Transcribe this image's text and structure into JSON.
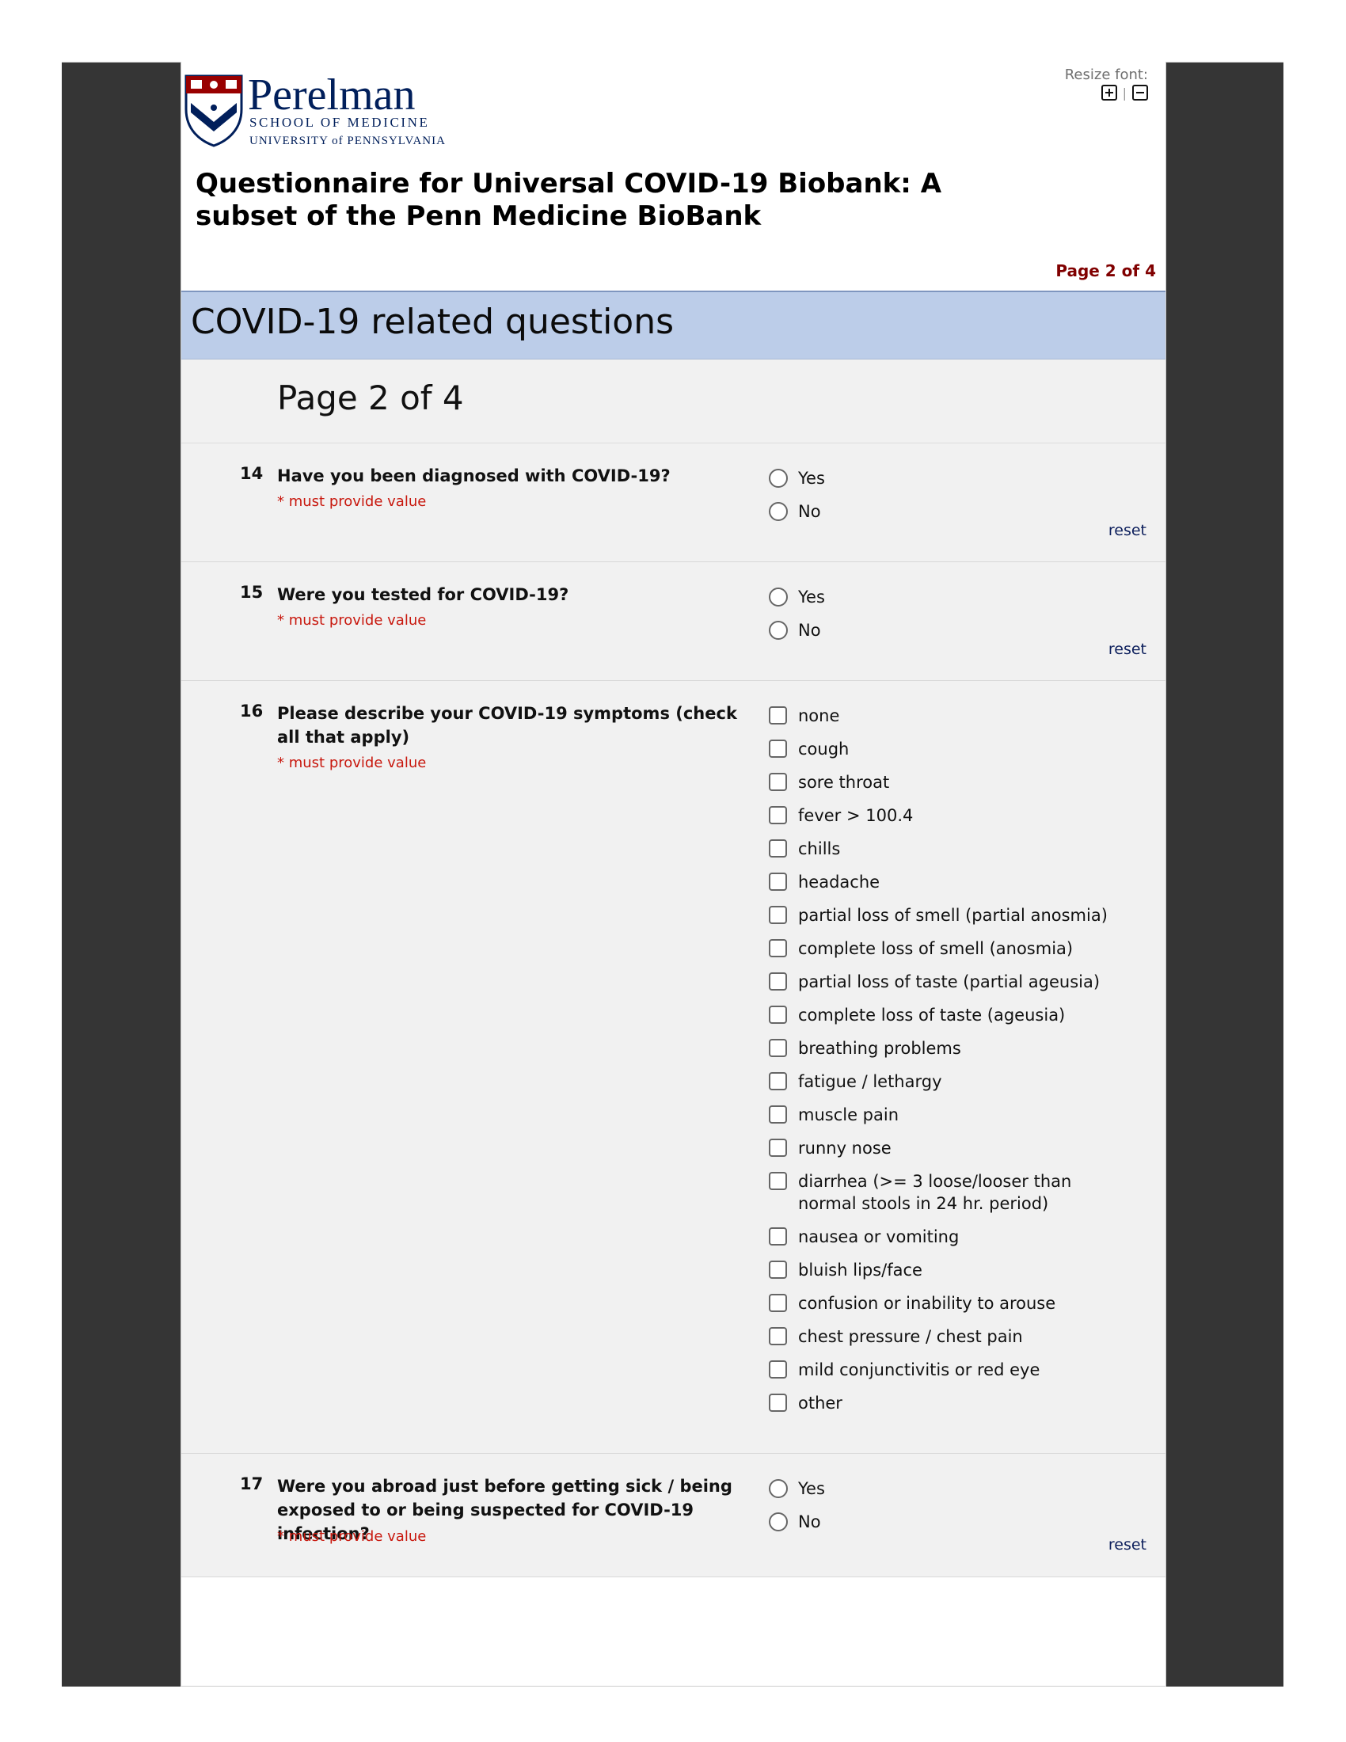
{
  "header": {
    "logo": {
      "name": "Perelman",
      "line1": "SCHOOL OF MEDICINE",
      "line2": "UNIVERSITY of PENNSYLVANIA"
    },
    "resize_font_label": "Resize font:",
    "resize_separator": "|",
    "survey_title": "Questionnaire for Universal COVID-19 Biobank: A subset of the Penn Medicine BioBank",
    "page_indicator": "Page 2 of 4"
  },
  "section": {
    "title": "COVID-19 related questions",
    "page_label": "Page 2 of 4"
  },
  "questions": [
    {
      "number": "14",
      "text": "Have you been diagnosed with COVID-19?",
      "required": "* must provide value",
      "type": "radio",
      "options": [
        "Yes",
        "No"
      ],
      "reset": "reset"
    },
    {
      "number": "15",
      "text": "Were you tested for COVID-19?",
      "required": "* must provide value",
      "type": "radio",
      "options": [
        "Yes",
        "No"
      ],
      "reset": "reset"
    },
    {
      "number": "16",
      "text": "Please describe your COVID-19 symptoms (check all that apply)",
      "required": "* must provide value",
      "type": "checkbox",
      "options": [
        "none",
        "cough",
        "sore throat",
        "fever > 100.4",
        "chills",
        "headache",
        "partial loss of smell (partial anosmia)",
        "complete loss of smell (anosmia)",
        "partial loss of taste (partial ageusia)",
        "complete loss of taste (ageusia)",
        "breathing problems",
        "fatigue / lethargy",
        "muscle pain",
        "runny nose",
        "diarrhea (>= 3 loose/looser than normal stools in 24 hr. period)",
        "nausea or vomiting",
        "bluish lips/face",
        "confusion or inability to arouse",
        "chest pressure / chest pain",
        "mild conjunctivitis or red eye",
        "other"
      ]
    },
    {
      "number": "17",
      "text": "Were you abroad just before getting sick / being exposed to or being suspected for COVID-19 infection?",
      "required": "* must provide value",
      "type": "radio",
      "options": [
        "Yes",
        "No"
      ],
      "reset": "reset"
    }
  ],
  "colors": {
    "section_header_bg": "#bccde9",
    "question_bg": "#f1f1f1",
    "required_red": "#c8180e",
    "page_indicator": "#800000",
    "logo_navy": "#011f5b",
    "logo_red": "#990000"
  }
}
